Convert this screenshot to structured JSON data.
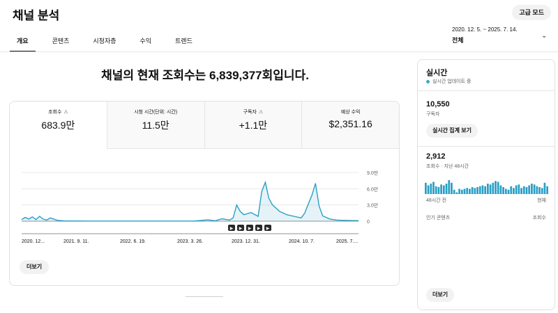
{
  "header": {
    "title": "채널 분석",
    "advanced_mode": "고급 모드"
  },
  "tabs": [
    {
      "label": "개요",
      "active": true
    },
    {
      "label": "콘텐츠",
      "active": false
    },
    {
      "label": "시청자층",
      "active": false
    },
    {
      "label": "수익",
      "active": false
    },
    {
      "label": "트렌드",
      "active": false
    }
  ],
  "date_range": {
    "range": "2020. 12. 5. ~ 2025. 7. 14.",
    "value": "전체"
  },
  "headline": "채널의 현재 조회수는 6,839,377회입니다.",
  "metrics": [
    {
      "label": "조회수",
      "value": "683.9만",
      "warning": true
    },
    {
      "label": "시청 시간(단위: 시간)",
      "value": "11.5만",
      "warning": false
    },
    {
      "label": "구독자",
      "value": "+1.1만",
      "warning": true
    },
    {
      "label": "예상 수익",
      "value": "$2,351.16",
      "warning": false
    }
  ],
  "chart_data": {
    "type": "line",
    "x_ticks": [
      "2020. 12...",
      "2021. 9. 11.",
      "2022. 6. 19.",
      "2023. 3. 26.",
      "2023. 12. 31.",
      "2024. 10. 7.",
      "2025. 7...."
    ],
    "y_ticks": [
      "9.0만",
      "6.0만",
      "3.0만",
      "0"
    ],
    "ylim": [
      0,
      90000
    ],
    "color": "#2a9fc4",
    "grid": true,
    "markers": [
      "▶",
      "▶",
      "▶",
      "▶",
      "▶"
    ],
    "points": [
      [
        0,
        3000
      ],
      [
        0.5,
        7000
      ],
      [
        1,
        4000
      ],
      [
        1.5,
        8000
      ],
      [
        2,
        3000
      ],
      [
        2.5,
        9000
      ],
      [
        3,
        4000
      ],
      [
        3.5,
        2000
      ],
      [
        4,
        6000
      ],
      [
        5,
        1500
      ],
      [
        6,
        500
      ],
      [
        8,
        400
      ],
      [
        10,
        300
      ],
      [
        12,
        300
      ],
      [
        14,
        200
      ],
      [
        16,
        200
      ],
      [
        18,
        200
      ],
      [
        20,
        200
      ],
      [
        22,
        200
      ],
      [
        24,
        300
      ],
      [
        26,
        2500
      ],
      [
        27,
        800
      ],
      [
        28,
        4500
      ],
      [
        29,
        2000
      ],
      [
        29.5,
        6000
      ],
      [
        30,
        30000
      ],
      [
        30.5,
        18000
      ],
      [
        31,
        12000
      ],
      [
        32,
        16000
      ],
      [
        33,
        9000
      ],
      [
        33.5,
        55000
      ],
      [
        34,
        72000
      ],
      [
        34.5,
        42000
      ],
      [
        35,
        30000
      ],
      [
        36,
        18000
      ],
      [
        37,
        12000
      ],
      [
        38,
        9000
      ],
      [
        39,
        6000
      ],
      [
        39.5,
        15000
      ],
      [
        40,
        32000
      ],
      [
        40.5,
        48000
      ],
      [
        41,
        70000
      ],
      [
        41.5,
        28000
      ],
      [
        42,
        10000
      ],
      [
        43,
        4000
      ],
      [
        44,
        2000
      ],
      [
        45,
        1500
      ],
      [
        46,
        1200
      ],
      [
        47,
        1000
      ]
    ]
  },
  "more_button": "더보기",
  "realtime": {
    "title": "실시간",
    "status": "실시간 업데이트 중",
    "subscribers": "10,550",
    "subscribers_label": "구독자",
    "live_count_button": "실시간 집계 보기",
    "views": "2,912",
    "views_label": "조회수 · 지난 48시간",
    "bars": [
      13,
      10,
      12,
      14,
      9,
      8,
      11,
      10,
      12,
      16,
      13,
      5,
      2,
      6,
      5,
      6,
      7,
      6,
      8,
      7,
      8,
      9,
      10,
      9,
      12,
      11,
      13,
      15,
      14,
      10,
      8,
      6,
      5,
      9,
      7,
      10,
      11,
      7,
      9,
      8,
      10,
      12,
      11,
      9,
      8,
      7,
      13,
      9
    ],
    "axis_left": "48시간 전",
    "axis_right": "현재",
    "top_content_label": "인기 콘텐츠",
    "top_content_metric": "조회수",
    "more_button": "더보기"
  }
}
